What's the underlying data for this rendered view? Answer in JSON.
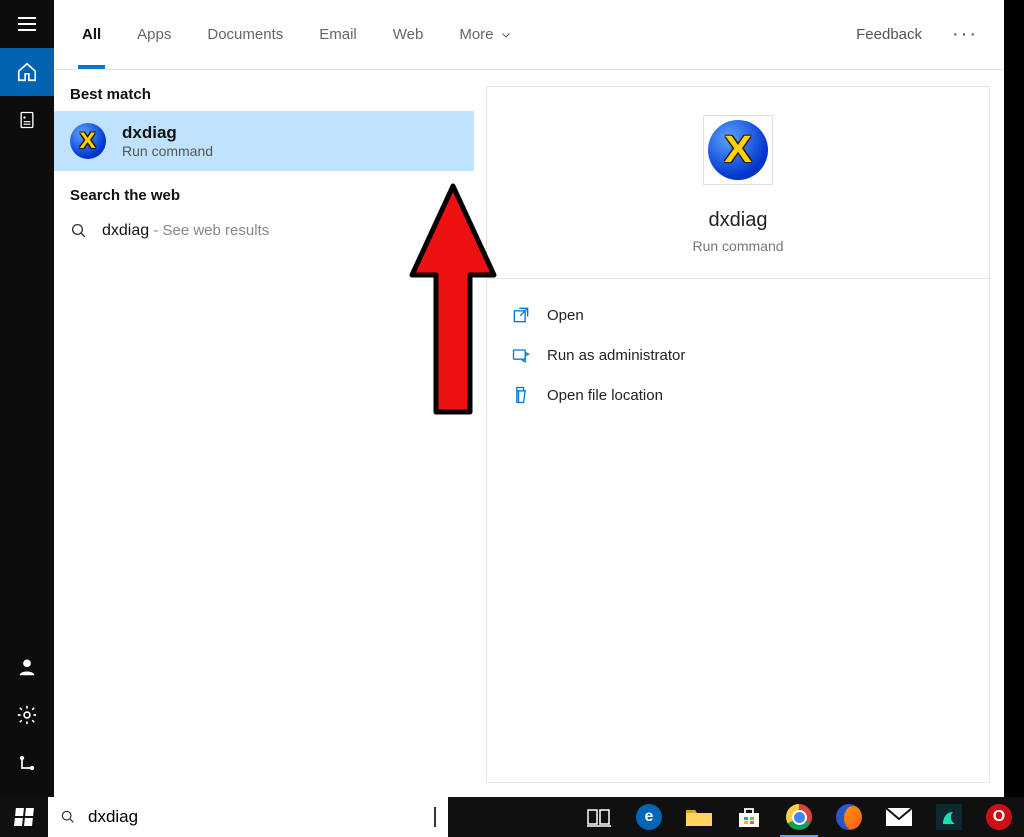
{
  "tabs": {
    "all": "All",
    "apps": "Apps",
    "documents": "Documents",
    "email": "Email",
    "web": "Web",
    "more": "More"
  },
  "header": {
    "feedback": "Feedback"
  },
  "sections": {
    "best_match": "Best match",
    "search_web": "Search the web"
  },
  "best_match": {
    "title": "dxdiag",
    "subtitle": "Run command"
  },
  "web_result": {
    "query": "dxdiag",
    "suffix": " - See web results"
  },
  "detail": {
    "title": "dxdiag",
    "subtitle": "Run command",
    "actions": {
      "open": "Open",
      "run_admin": "Run as administrator",
      "open_location": "Open file location"
    }
  },
  "search_box": {
    "value": "dxdiag"
  }
}
